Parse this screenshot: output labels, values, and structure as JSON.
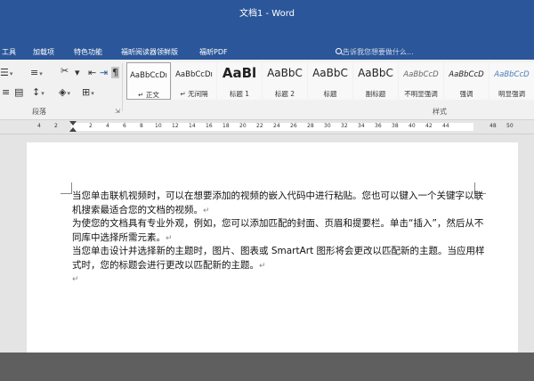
{
  "window": {
    "title": "文档1 - Word"
  },
  "menu": {
    "items": [
      "工具",
      "加载项",
      "特色功能",
      "福昕阅读器领鲜版",
      "福昕PDF"
    ],
    "search_placeholder": "告诉我您想要做什么..."
  },
  "ribbon": {
    "paragraph_group_label": "段落",
    "styles_group_label": "样式",
    "styles": [
      {
        "sample": "AaBbCcDı",
        "name": "↵ 正文"
      },
      {
        "sample": "AaBbCcDı",
        "name": "↵ 无间隔"
      },
      {
        "sample": "AaBl",
        "name": "标题 1"
      },
      {
        "sample": "AaBbC",
        "name": "标题 2"
      },
      {
        "sample": "AaBbC",
        "name": "标题"
      },
      {
        "sample": "AaBbC",
        "name": "副标题"
      },
      {
        "sample": "AaBbCcD",
        "name": "不明显强调"
      },
      {
        "sample": "AaBbCcD",
        "name": "强调"
      },
      {
        "sample": "AaBbCcD",
        "name": "明显强调"
      }
    ]
  },
  "ruler": {
    "labels": [
      "4",
      "2",
      "2",
      "4",
      "6",
      "8",
      "10",
      "12",
      "14",
      "16",
      "18",
      "20",
      "22",
      "24",
      "26",
      "28",
      "30",
      "32",
      "34",
      "36",
      "38",
      "40",
      "42",
      "44",
      "48",
      "50"
    ]
  },
  "document": {
    "paragraphs": [
      "当您单击联机视频时，可以在想要添加的视频的嵌入代码中进行粘贴。您也可以键入一个关键字以联机搜索最适合您的文档的视频。",
      "为使您的文档具有专业外观，例如，您可以添加匹配的封面、页眉和提要栏。单击“插入”，然后从不同库中选择所需元素。",
      "当您单击设计并选择新的主题时，图片、图表或 SmartArt 图形将会更改以匹配新的主题。当应用样式时，您的标题会进行更改以匹配新的主题。"
    ],
    "paragraph_mark": "↵"
  }
}
